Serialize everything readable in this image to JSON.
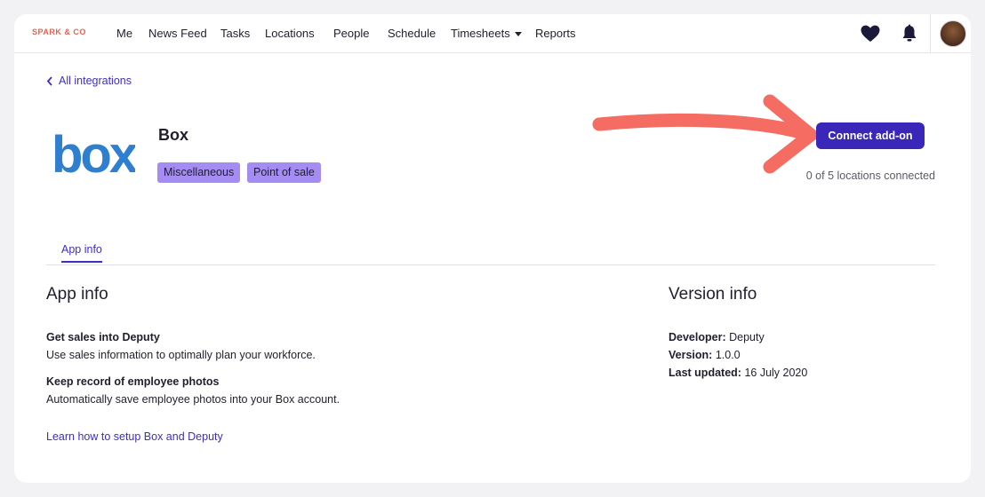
{
  "brand": "SPARK & CO",
  "nav": {
    "items": [
      "Me",
      "News Feed",
      "Tasks",
      "Locations",
      "People",
      "Schedule",
      "Timesheets",
      "Reports"
    ],
    "icons": [
      "heart-icon",
      "bell-icon",
      "avatar"
    ]
  },
  "back_link": "All integrations",
  "app": {
    "name": "Box",
    "logo_text": "box",
    "tags": [
      "Miscellaneous",
      "Point of sale"
    ],
    "connect_label": "Connect add-on",
    "location_status": "0 of 5 locations connected"
  },
  "tabs": [
    "App info"
  ],
  "app_info": {
    "heading": "App info",
    "features": [
      {
        "title": "Get sales into Deputy",
        "desc": "Use sales information to optimally plan your workforce."
      },
      {
        "title": "Keep record of employee photos",
        "desc": "Automatically save employee photos into your Box account."
      }
    ],
    "learn_link": "Learn how to setup Box and Deputy"
  },
  "version_info": {
    "heading": "Version info",
    "developer_label": "Developer:",
    "developer": "Deputy",
    "version_label": "Version:",
    "version": "1.0.0",
    "updated_label": "Last updated:",
    "updated": "16 July 2020"
  },
  "colors": {
    "accent": "#3a26b8",
    "tag": "#a58cf2",
    "annotation_arrow": "#f46c62",
    "brand": "#e8604f",
    "box_logo": "#2f7fd1"
  }
}
